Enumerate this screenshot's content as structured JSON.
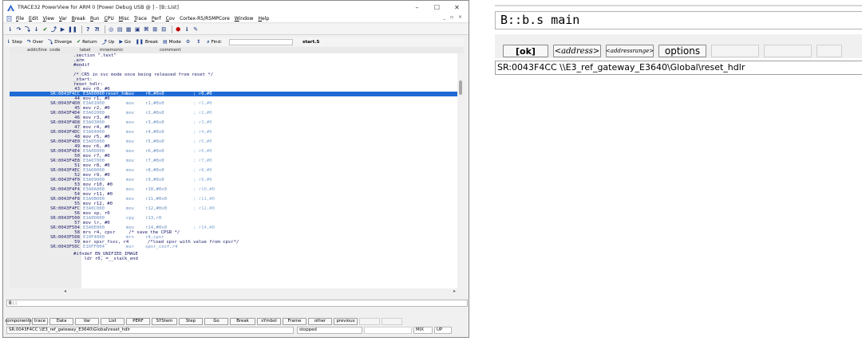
{
  "window": {
    "title": "TRACE32 PowerView for ARM 0 [Power Debug USB @ ] - [B::List]",
    "controls": [
      "–",
      "☐",
      "✕"
    ],
    "mdi_controls": "_ ▫ ×"
  },
  "menu": {
    "items": [
      {
        "ul": "F",
        "rest": "ile"
      },
      {
        "ul": "E",
        "rest": "dit"
      },
      {
        "ul": "V",
        "rest": "iew"
      },
      {
        "ul": "V",
        "rest": "ar"
      },
      {
        "ul": "B",
        "rest": "reak"
      },
      {
        "ul": "R",
        "rest": "un"
      },
      {
        "ul": "C",
        "rest": "PU"
      },
      {
        "ul": "M",
        "rest": "isc"
      },
      {
        "ul": "T",
        "rest": "race"
      },
      {
        "ul": "P",
        "rest": "erf"
      },
      {
        "ul": "C",
        "rest": "ov"
      },
      {
        "ul": "",
        "rest": "Cortex-R5/R5MPCore"
      },
      {
        "ul": "W",
        "rest": "indow"
      },
      {
        "ul": "H",
        "rest": "elp"
      }
    ]
  },
  "list_toolbar": {
    "step": "Step",
    "over": "Over",
    "diverge": "Diverge",
    "return": "Return",
    "up": "Up",
    "go": "Go",
    "break": "Break",
    "mode": "Mode",
    "find_label": "Find:",
    "find_value": "start.S"
  },
  "list_header": {
    "addr": "addr/line",
    "code": "code",
    "label": "label",
    "mnemonic": "mnemonic",
    "comment": "comment"
  },
  "source_top": [
    ".section \".text\"",
    ".arm",
    "#endif",
    "",
    "/* CR5 in svc mode once being released from reset */",
    "_start:",
    "reset_hdlr:"
  ],
  "rows": [
    {
      "line": "43",
      "src": "mov r0, #0",
      "addr": "SR:0043F4CC",
      "code": "E3A00000",
      "label": "reset_hd..",
      "mnem": "mov",
      "ops": "r0,#0x0",
      "cmt": "; r0,#0",
      "selected": true
    },
    {
      "line": "44",
      "src": "mov r1, #0",
      "addr": "SR:0043F4D0",
      "code": "E3A01000",
      "label": "",
      "mnem": "mov",
      "ops": "r1,#0x0",
      "cmt": "; r1,#0"
    },
    {
      "line": "45",
      "src": "mov r2, #0",
      "addr": "SR:0043F4D4",
      "code": "E3A02000",
      "label": "",
      "mnem": "mov",
      "ops": "r2,#0x0",
      "cmt": "; r2,#0"
    },
    {
      "line": "46",
      "src": "mov r3, #0",
      "addr": "SR:0043F4D8",
      "code": "E3A03000",
      "label": "",
      "mnem": "mov",
      "ops": "r3,#0x0",
      "cmt": "; r3,#0"
    },
    {
      "line": "47",
      "src": "mov r4, #0",
      "addr": "SR:0043F4DC",
      "code": "E3A04000",
      "label": "",
      "mnem": "mov",
      "ops": "r4,#0x0",
      "cmt": "; r4,#0"
    },
    {
      "line": "48",
      "src": "mov r5, #0",
      "addr": "SR:0043F4E0",
      "code": "E3A05000",
      "label": "",
      "mnem": "mov",
      "ops": "r5,#0x0",
      "cmt": "; r5,#0"
    },
    {
      "line": "49",
      "src": "mov r6, #0",
      "addr": "SR:0043F4E4",
      "code": "E3A06000",
      "label": "",
      "mnem": "mov",
      "ops": "r6,#0x0",
      "cmt": "; r6,#0"
    },
    {
      "line": "50",
      "src": "mov r7, #0",
      "addr": "SR:0043F4E8",
      "code": "E3A07000",
      "label": "",
      "mnem": "mov",
      "ops": "r7,#0x0",
      "cmt": "; r7,#0"
    },
    {
      "line": "51",
      "src": "mov r8, #0",
      "addr": "SR:0043F4EC",
      "code": "E3A08000",
      "label": "",
      "mnem": "mov",
      "ops": "r8,#0x0",
      "cmt": "; r8,#0"
    },
    {
      "line": "52",
      "src": "mov r9, #0",
      "addr": "SR:0043F4F0",
      "code": "E3A09000",
      "label": "",
      "mnem": "mov",
      "ops": "r9,#0x0",
      "cmt": "; r9,#0"
    },
    {
      "line": "53",
      "src": "mov r10, #0",
      "addr": "SR:0043F4F4",
      "code": "E3A0A000",
      "label": "",
      "mnem": "mov",
      "ops": "r10,#0x0",
      "cmt": "; r10,#0"
    },
    {
      "line": "54",
      "src": "mov r11, #0",
      "addr": "SR:0043F4F8",
      "code": "E3A0B000",
      "label": "",
      "mnem": "mov",
      "ops": "r11,#0x0",
      "cmt": "; r11,#0"
    },
    {
      "line": "55",
      "src": "mov r12, #0",
      "addr": "SR:0043F4FC",
      "code": "E3A0C000",
      "label": "",
      "mnem": "mov",
      "ops": "r12,#0x0",
      "cmt": "; r12,#0"
    },
    {
      "line": "56",
      "src": "mov sp, r0",
      "addr": "SR:0043F500",
      "code": "E1A0D000",
      "label": "",
      "mnem": "cpy",
      "ops": "r13,r0",
      "cmt": ""
    },
    {
      "line": "57",
      "src": "mov lr, #0",
      "addr": "SR:0043F504",
      "code": "E3A0E000",
      "label": "",
      "mnem": "mov",
      "ops": "r14,#0x0",
      "cmt": "; r14,#0"
    },
    {
      "line": "58",
      "src": "mrs r4, cpsr     /* save the CPSR */",
      "addr": "SR:0043F508",
      "code": "E10F4000",
      "label": "",
      "mnem": "mrs",
      "ops": "r4,cpsr",
      "cmt": ""
    },
    {
      "line": "59",
      "src": "msr spsr_fsxc, r4       /*load spsr with value from cpsr*/",
      "addr": "SR:0043F50C",
      "code": "E16FF004",
      "label": "",
      "mnem": "msr",
      "ops": "spsr_cxsf,r4",
      "cmt": ""
    }
  ],
  "source_bottom": [
    "#ifndef EN_UNIFIED_IMAGE",
    "    ldr r0, =__stack_end"
  ],
  "command_line": "B::",
  "softkeys": [
    "components",
    "trace",
    "Data",
    "Var",
    "List",
    "PERF",
    "SYStem",
    "Step",
    "Go",
    "Break",
    "sYmbol",
    "Frame",
    "other",
    "previous"
  ],
  "status": {
    "path": "SR:0043F4CC  \\\\E3_ref_gateway_E3640\\Global\\reset_hdlr",
    "state": "stopped",
    "mode": "MIX",
    "up": "UP"
  },
  "zoom": {
    "command": "B::b.s main",
    "keys": [
      "[ok]",
      "<address>",
      "<addressrange>",
      "options"
    ],
    "status": "SR:0043F4CC  \\\\E3_ref_gateway_E3640\\Global\\reset_hdlr"
  },
  "colors": {
    "selection": "#1e6bd6",
    "source_text": "#1a1a6a",
    "asm_text": "#6c8fc0"
  }
}
